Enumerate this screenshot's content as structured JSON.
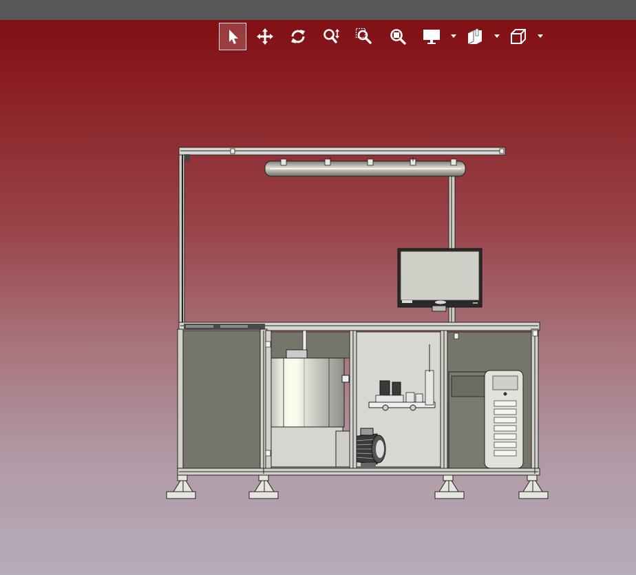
{
  "app": {
    "colors": {
      "titlebar": "#575757",
      "background_top": "#7e0a0e",
      "background_bottom": "#b5adb9",
      "toolbar_icon": "#ffffff"
    }
  },
  "toolbar": {
    "buttons": [
      {
        "id": "select",
        "icon": "pointer-arrow-icon",
        "active": true
      },
      {
        "id": "pan",
        "icon": "move-arrows-icon",
        "active": false
      },
      {
        "id": "rotate",
        "icon": "rotate-icon",
        "active": false
      },
      {
        "id": "zoom",
        "icon": "zoom-updown-icon",
        "active": false
      },
      {
        "id": "zoom-window",
        "icon": "zoom-window-icon",
        "active": false
      },
      {
        "id": "zoom-fit",
        "icon": "zoom-fit-icon",
        "active": false
      },
      {
        "id": "display-mode",
        "icon": "monitor-icon",
        "dropdown": true
      },
      {
        "id": "section",
        "icon": "section-plane-icon",
        "dropdown": true
      },
      {
        "id": "view-cube",
        "icon": "cube-view-icon",
        "dropdown": true
      }
    ]
  },
  "model": {
    "description_icon": "workstation-cad-model",
    "components": [
      "frame",
      "overhead-light",
      "monitor",
      "tank",
      "motor-pump",
      "manifold",
      "pc-tower",
      "leveling-feet"
    ]
  }
}
